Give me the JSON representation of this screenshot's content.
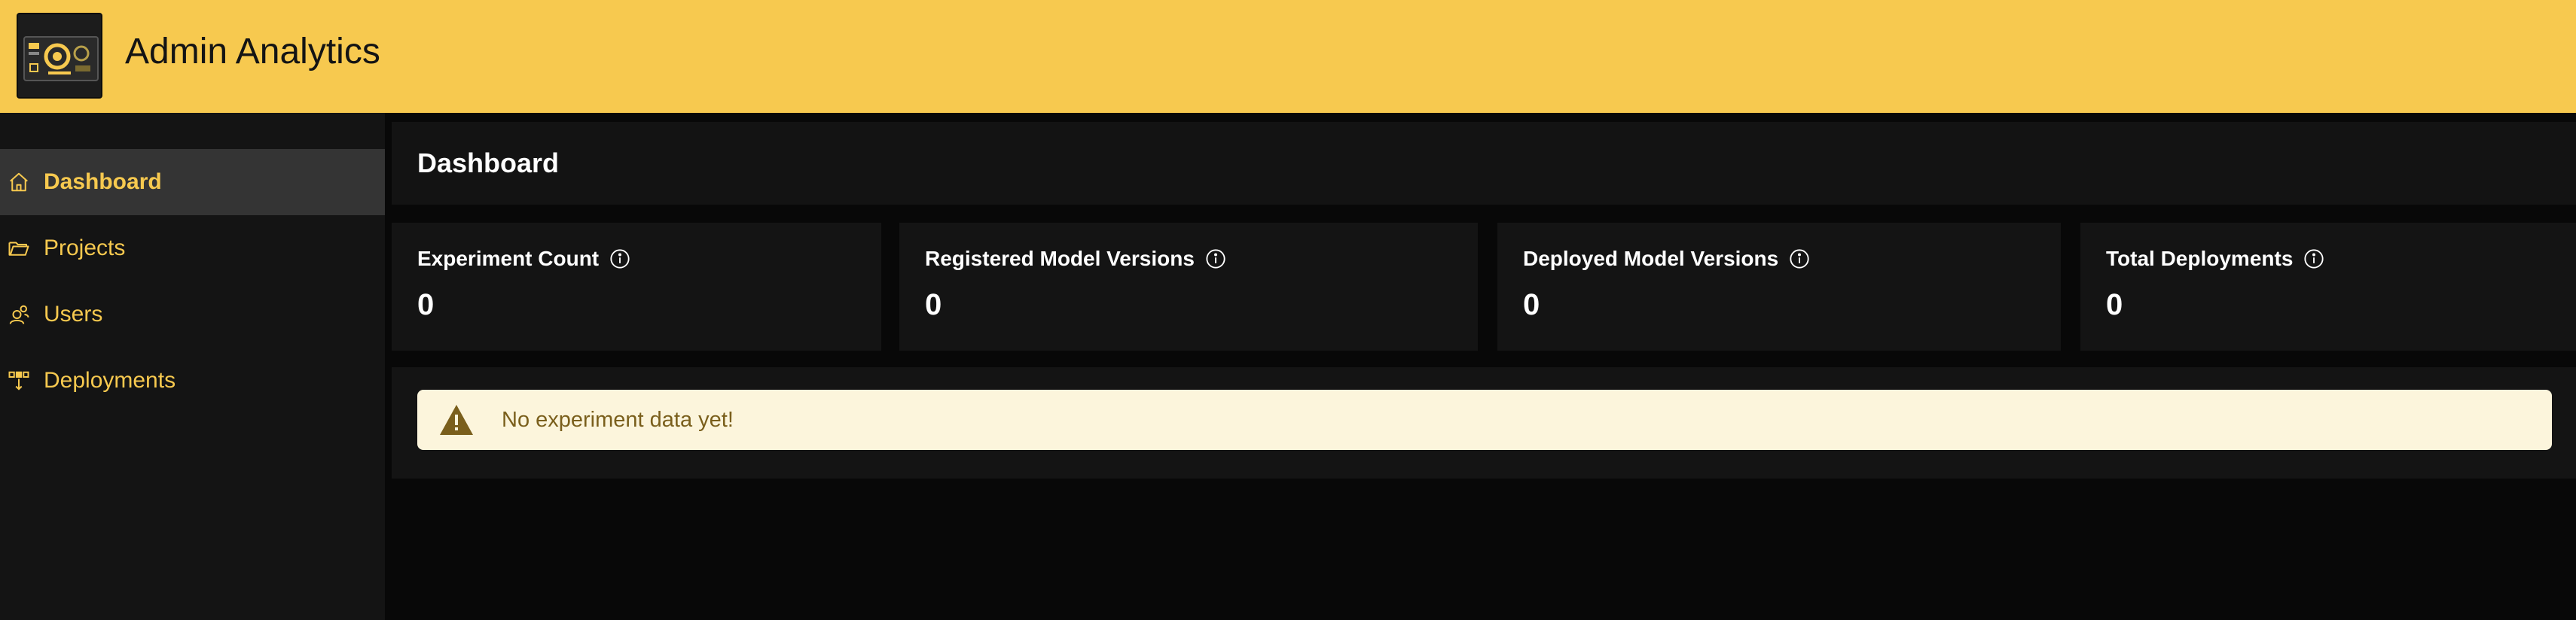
{
  "header": {
    "app_title": "Admin Analytics",
    "logo_icon": "dashboard-gauge-logo",
    "background_color": "#f7c94f"
  },
  "sidebar": {
    "items": [
      {
        "label": "Dashboard",
        "icon": "home-icon",
        "active": true
      },
      {
        "label": "Projects",
        "icon": "folder-icon",
        "active": false
      },
      {
        "label": "Users",
        "icon": "users-icon",
        "active": false
      },
      {
        "label": "Deployments",
        "icon": "deployments-icon",
        "active": false
      }
    ],
    "accent_color": "#f7c94f"
  },
  "main": {
    "page_title": "Dashboard",
    "stats": [
      {
        "label": "Experiment Count",
        "value": "0",
        "icon": "info-icon"
      },
      {
        "label": "Registered Model Versions",
        "value": "0",
        "icon": "info-icon"
      },
      {
        "label": "Deployed Model Versions",
        "value": "0",
        "icon": "info-icon"
      },
      {
        "label": "Total Deployments",
        "value": "0",
        "icon": "info-icon"
      }
    ],
    "alert": {
      "text": "No experiment data yet!",
      "icon": "warning-icon",
      "background_color": "#fcf5dc",
      "text_color": "#7a5f1c"
    }
  }
}
